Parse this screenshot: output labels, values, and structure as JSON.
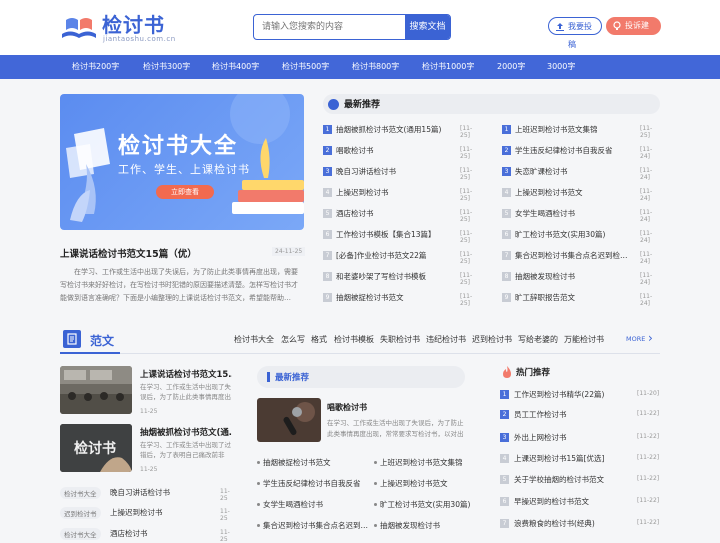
{
  "site": {
    "name": "检讨书",
    "domain": "jiantaoshu.com.cn"
  },
  "search": {
    "placeholder": "请输入您搜索的内容",
    "button": "搜索文档"
  },
  "actions": {
    "submit": "我要投稿",
    "feedback": "投诉建议"
  },
  "nav": [
    "检讨书200字",
    "检讨书300字",
    "检讨书400字",
    "检讨书500字",
    "检讨书800字",
    "检讨书1000字",
    "2000字",
    "3000字"
  ],
  "hero": {
    "title": "检讨书大全",
    "subtitle": "工作、学生、上课检讨书",
    "button": "立即查看"
  },
  "featured": {
    "title": "上课说话检讨书范文15篇（优）",
    "date": "24-11-25",
    "desc": "在学习、工作或生活中出现了失误后，为了防止此类事情再度出现，需要写检讨书来好好检讨，在写检讨书时犯错的原因要描述清楚。怎样写检讨书才能做到语言准确呢？下面是小编整理的上课说话检讨书范文，希望能帮助…"
  },
  "recommend": {
    "title": "最新推荐",
    "left": [
      {
        "n": "1",
        "text": "抽烟被抓检讨书范文(通用15篇)",
        "date": "[11-25]"
      },
      {
        "n": "2",
        "text": "唱歌检讨书",
        "date": "[11-25]"
      },
      {
        "n": "3",
        "text": "晚自习讲话检讨书",
        "date": "[11-25]"
      },
      {
        "n": "4",
        "text": "上操迟到检讨书",
        "date": "[11-25]"
      },
      {
        "n": "5",
        "text": "酒店检讨书",
        "date": "[11-25]"
      },
      {
        "n": "6",
        "text": "工作检讨书模板【集合13篇】",
        "date": "[11-25]"
      },
      {
        "n": "7",
        "text": "[必备]作业检讨书范文22篇",
        "date": "[11-25]"
      },
      {
        "n": "8",
        "text": "和老婆吵架了写检讨书模板",
        "date": "[11-25]"
      },
      {
        "n": "9",
        "text": "抽烟被捉检讨书范文",
        "date": "[11-25]"
      }
    ],
    "right": [
      {
        "n": "1",
        "text": "上班迟到检讨书范文集锦",
        "date": "[11-25]"
      },
      {
        "n": "2",
        "text": "学生违反纪律检讨书自我反省",
        "date": "[11-24]"
      },
      {
        "n": "3",
        "text": "失恋旷课检讨书",
        "date": "[11-24]"
      },
      {
        "n": "4",
        "text": "上操迟到检讨书范文",
        "date": "[11-24]"
      },
      {
        "n": "5",
        "text": "女学生喝酒检讨书",
        "date": "[11-24]"
      },
      {
        "n": "6",
        "text": "旷工检讨书范文(实用30篇)",
        "date": "[11-24]"
      },
      {
        "n": "7",
        "text": "集合迟到检讨书集合点名迟到检…",
        "date": "[11-24]"
      },
      {
        "n": "8",
        "text": "抽烟被发现检讨书",
        "date": "[11-24]"
      },
      {
        "n": "9",
        "text": "旷工辞职报告范文",
        "date": "[11-24]"
      }
    ]
  },
  "section": {
    "title": "范文",
    "tabs": [
      "检讨书大全",
      "怎么写",
      "格式",
      "检讨书模板",
      "失职检讨书",
      "违纪检讨书",
      "迟到检讨书",
      "写给老婆的",
      "万能检讨书"
    ],
    "more": "MORE"
  },
  "thumbs": [
    {
      "title": "上课说话检讨书范文15…",
      "desc": "在学习、工作或生活中出现了失误后，为了防止此类事情再度出现",
      "date": "11-25"
    },
    {
      "title": "抽烟被抓检讨书范文(通…",
      "desc": "在学习、工作或生活中出现了过错后，为了表明自己痛改前非",
      "date": "11-25",
      "overlay": "检讨书"
    }
  ],
  "tagged": [
    {
      "tag": "检讨书大全",
      "text": "晚自习讲话检讨书",
      "date": "11-25"
    },
    {
      "tag": "迟到检讨书",
      "text": "上操迟到检讨书",
      "date": "11-25"
    },
    {
      "tag": "检讨书大全",
      "text": "酒店检讨书",
      "date": "11-25"
    }
  ],
  "latest": {
    "title": "最新推荐",
    "card": {
      "title": "唱歌检讨书",
      "desc": "在学习、工作或生活中出现了失误后，为了防止此类事情再度出现，常常要求写检讨书，以对出"
    },
    "items": [
      "抽烟被捉检讨书范文",
      "上班迟到检讨书范文集锦",
      "学生违反纪律检讨书自我反省",
      "上操迟到检讨书范文",
      "女学生喝酒检讨书",
      "旷工检讨书范文(实用30篇)",
      "集合迟到检讨书集合点名迟到…",
      "抽烟被发现检讨书"
    ]
  },
  "hot": {
    "title": "热门推荐",
    "items": [
      {
        "n": "1",
        "text": "工作迟到检讨书精华(22篇)",
        "date": "[11-20]"
      },
      {
        "n": "2",
        "text": "员工工作检讨书",
        "date": "[11-22]"
      },
      {
        "n": "3",
        "text": "外出上网检讨书",
        "date": "[11-22]"
      },
      {
        "n": "4",
        "text": "上课迟到检讨书15篇[优选]",
        "date": "[11-22]"
      },
      {
        "n": "5",
        "text": "关于学校抽烟的检讨书范文",
        "date": "[11-22]"
      },
      {
        "n": "6",
        "text": "早操迟到的检讨书范文",
        "date": "[11-22]"
      },
      {
        "n": "7",
        "text": "浪费粮食的检讨书(经典)",
        "date": "[11-22]"
      }
    ]
  },
  "colors": {
    "brand": "#3b63d4",
    "nav": "#4267d8",
    "accent": "#f27a6b"
  }
}
